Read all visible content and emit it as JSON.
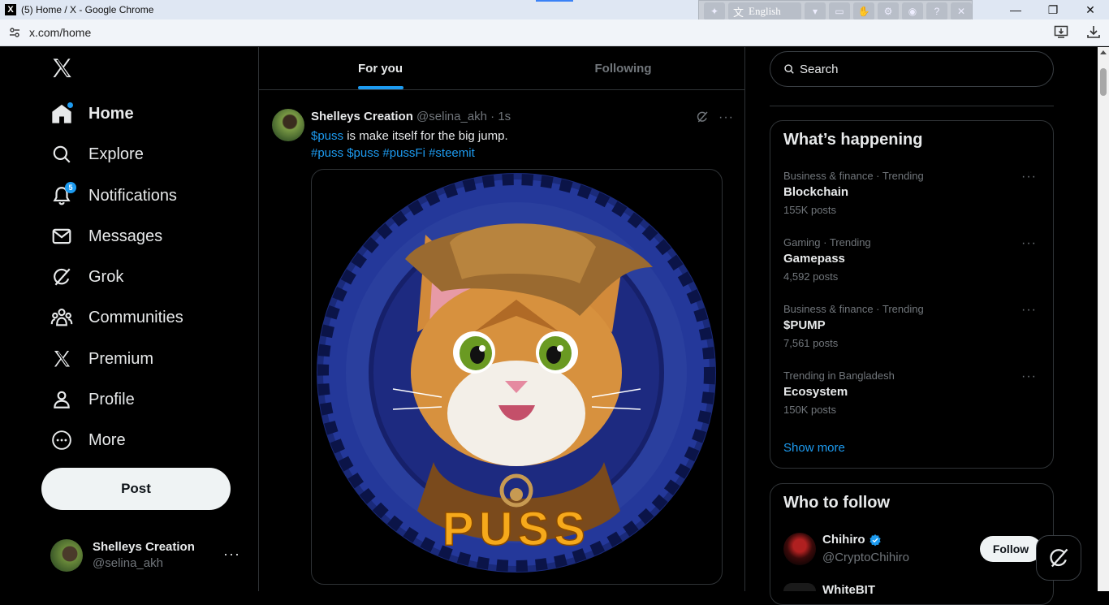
{
  "browser": {
    "window_title": "(5) Home / X - Google Chrome",
    "favicon": "X",
    "url": "x.com/home",
    "language": "English"
  },
  "nav": {
    "items": [
      {
        "label": "Home",
        "icon": "home-icon"
      },
      {
        "label": "Explore",
        "icon": "search-icon"
      },
      {
        "label": "Notifications",
        "icon": "bell-icon",
        "badge": "5"
      },
      {
        "label": "Messages",
        "icon": "envelope-icon"
      },
      {
        "label": "Grok",
        "icon": "grok-icon"
      },
      {
        "label": "Communities",
        "icon": "people-icon"
      },
      {
        "label": "Premium",
        "icon": "x-logo-icon"
      },
      {
        "label": "Profile",
        "icon": "person-icon"
      },
      {
        "label": "More",
        "icon": "more-circle-icon"
      }
    ],
    "post_label": "Post"
  },
  "account": {
    "name": "Shelleys Creation",
    "handle": "@selina_akh"
  },
  "tabs": {
    "for_you": "For you",
    "following": "Following"
  },
  "tweet": {
    "name": "Shelleys Creation",
    "meta": " @selina_akh · 1s",
    "text_link": "$puss",
    "text_rest": " is make itself for the big jump.",
    "hashtags": "#puss $puss #pussFi #steemit",
    "image_text": "PUSS"
  },
  "search": {
    "placeholder": "Search"
  },
  "trending": {
    "title": "What’s happening",
    "items": [
      {
        "context": "Business & finance · Trending",
        "name": "Blockchain",
        "count": "155K posts"
      },
      {
        "context": "Gaming · Trending",
        "name": "Gamepass",
        "count": "4,592 posts"
      },
      {
        "context": "Business & finance · Trending",
        "name": "$PUMP",
        "count": "7,561 posts"
      },
      {
        "context": "Trending in Bangladesh",
        "name": "Ecosystem",
        "count": "150K posts"
      }
    ],
    "show_more": "Show more"
  },
  "who_to_follow": {
    "title": "Who to follow",
    "items": [
      {
        "name": "Chihiro",
        "handle": "@CryptoChihiro",
        "button": "Follow"
      },
      {
        "name": "WhiteBIT"
      }
    ]
  },
  "colors": {
    "accent": "#1d9bf0",
    "background": "#000000",
    "text": "#e7e9ea",
    "muted": "#71767b",
    "border": "#2f3336"
  }
}
